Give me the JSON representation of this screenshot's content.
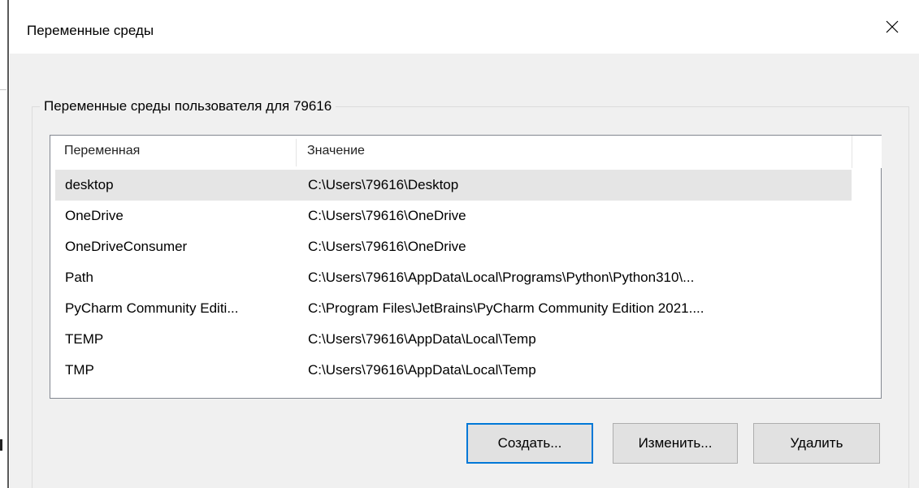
{
  "window": {
    "title": "Переменные среды",
    "close_icon": "close-icon"
  },
  "user_group": {
    "label": "Переменные среды пользователя для 79616",
    "columns": [
      "Переменная",
      "Значение"
    ],
    "rows": [
      {
        "name": "desktop",
        "value": "C:\\Users\\79616\\Desktop",
        "selected": true
      },
      {
        "name": "OneDrive",
        "value": "C:\\Users\\79616\\OneDrive",
        "selected": false
      },
      {
        "name": "OneDriveConsumer",
        "value": "C:\\Users\\79616\\OneDrive",
        "selected": false
      },
      {
        "name": "Path",
        "value": "C:\\Users\\79616\\AppData\\Local\\Programs\\Python\\Python310\\...",
        "selected": false
      },
      {
        "name": "PyCharm Community Editi...",
        "value": "C:\\Program Files\\JetBrains\\PyCharm Community Edition 2021....",
        "selected": false
      },
      {
        "name": "TEMP",
        "value": "C:\\Users\\79616\\AppData\\Local\\Temp",
        "selected": false
      },
      {
        "name": "TMP",
        "value": "C:\\Users\\79616\\AppData\\Local\\Temp",
        "selected": false
      }
    ],
    "buttons": {
      "create": "Создать...",
      "edit": "Изменить...",
      "delete": "Удалить"
    }
  },
  "colors": {
    "dialog_bg": "#f0f0f0",
    "selection_bg": "#e5e5e5",
    "default_button_border": "#0078d7",
    "button_bg": "#e1e1e1"
  }
}
